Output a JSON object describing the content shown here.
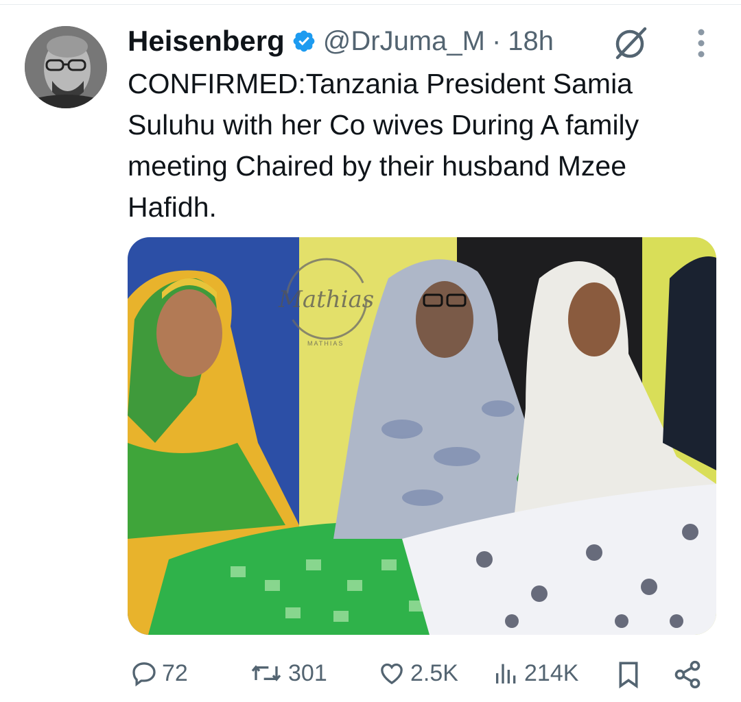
{
  "tweet": {
    "author_name": "Heisenberg",
    "handle": "@DrJuma_M",
    "separator": "·",
    "time": "18h",
    "text": "CONFIRMED:Tanzania President Samia Suluhu with her Co wives During A family meeting Chaired by their husband Mzee Hafidh.",
    "media_watermark": "Mathias",
    "media_watermark_sub": "MATHIAS"
  },
  "stats": {
    "replies": "72",
    "retweets": "301",
    "likes": "2.5K",
    "views": "214K"
  },
  "colors": {
    "verified": "#1d9bf0",
    "secondary_text": "#536471",
    "primary_text": "#0f1419"
  },
  "icons": [
    "verified-badge-icon",
    "grok-icon",
    "more-icon",
    "reply-icon",
    "retweet-icon",
    "like-icon",
    "views-icon",
    "bookmark-icon",
    "share-icon"
  ]
}
